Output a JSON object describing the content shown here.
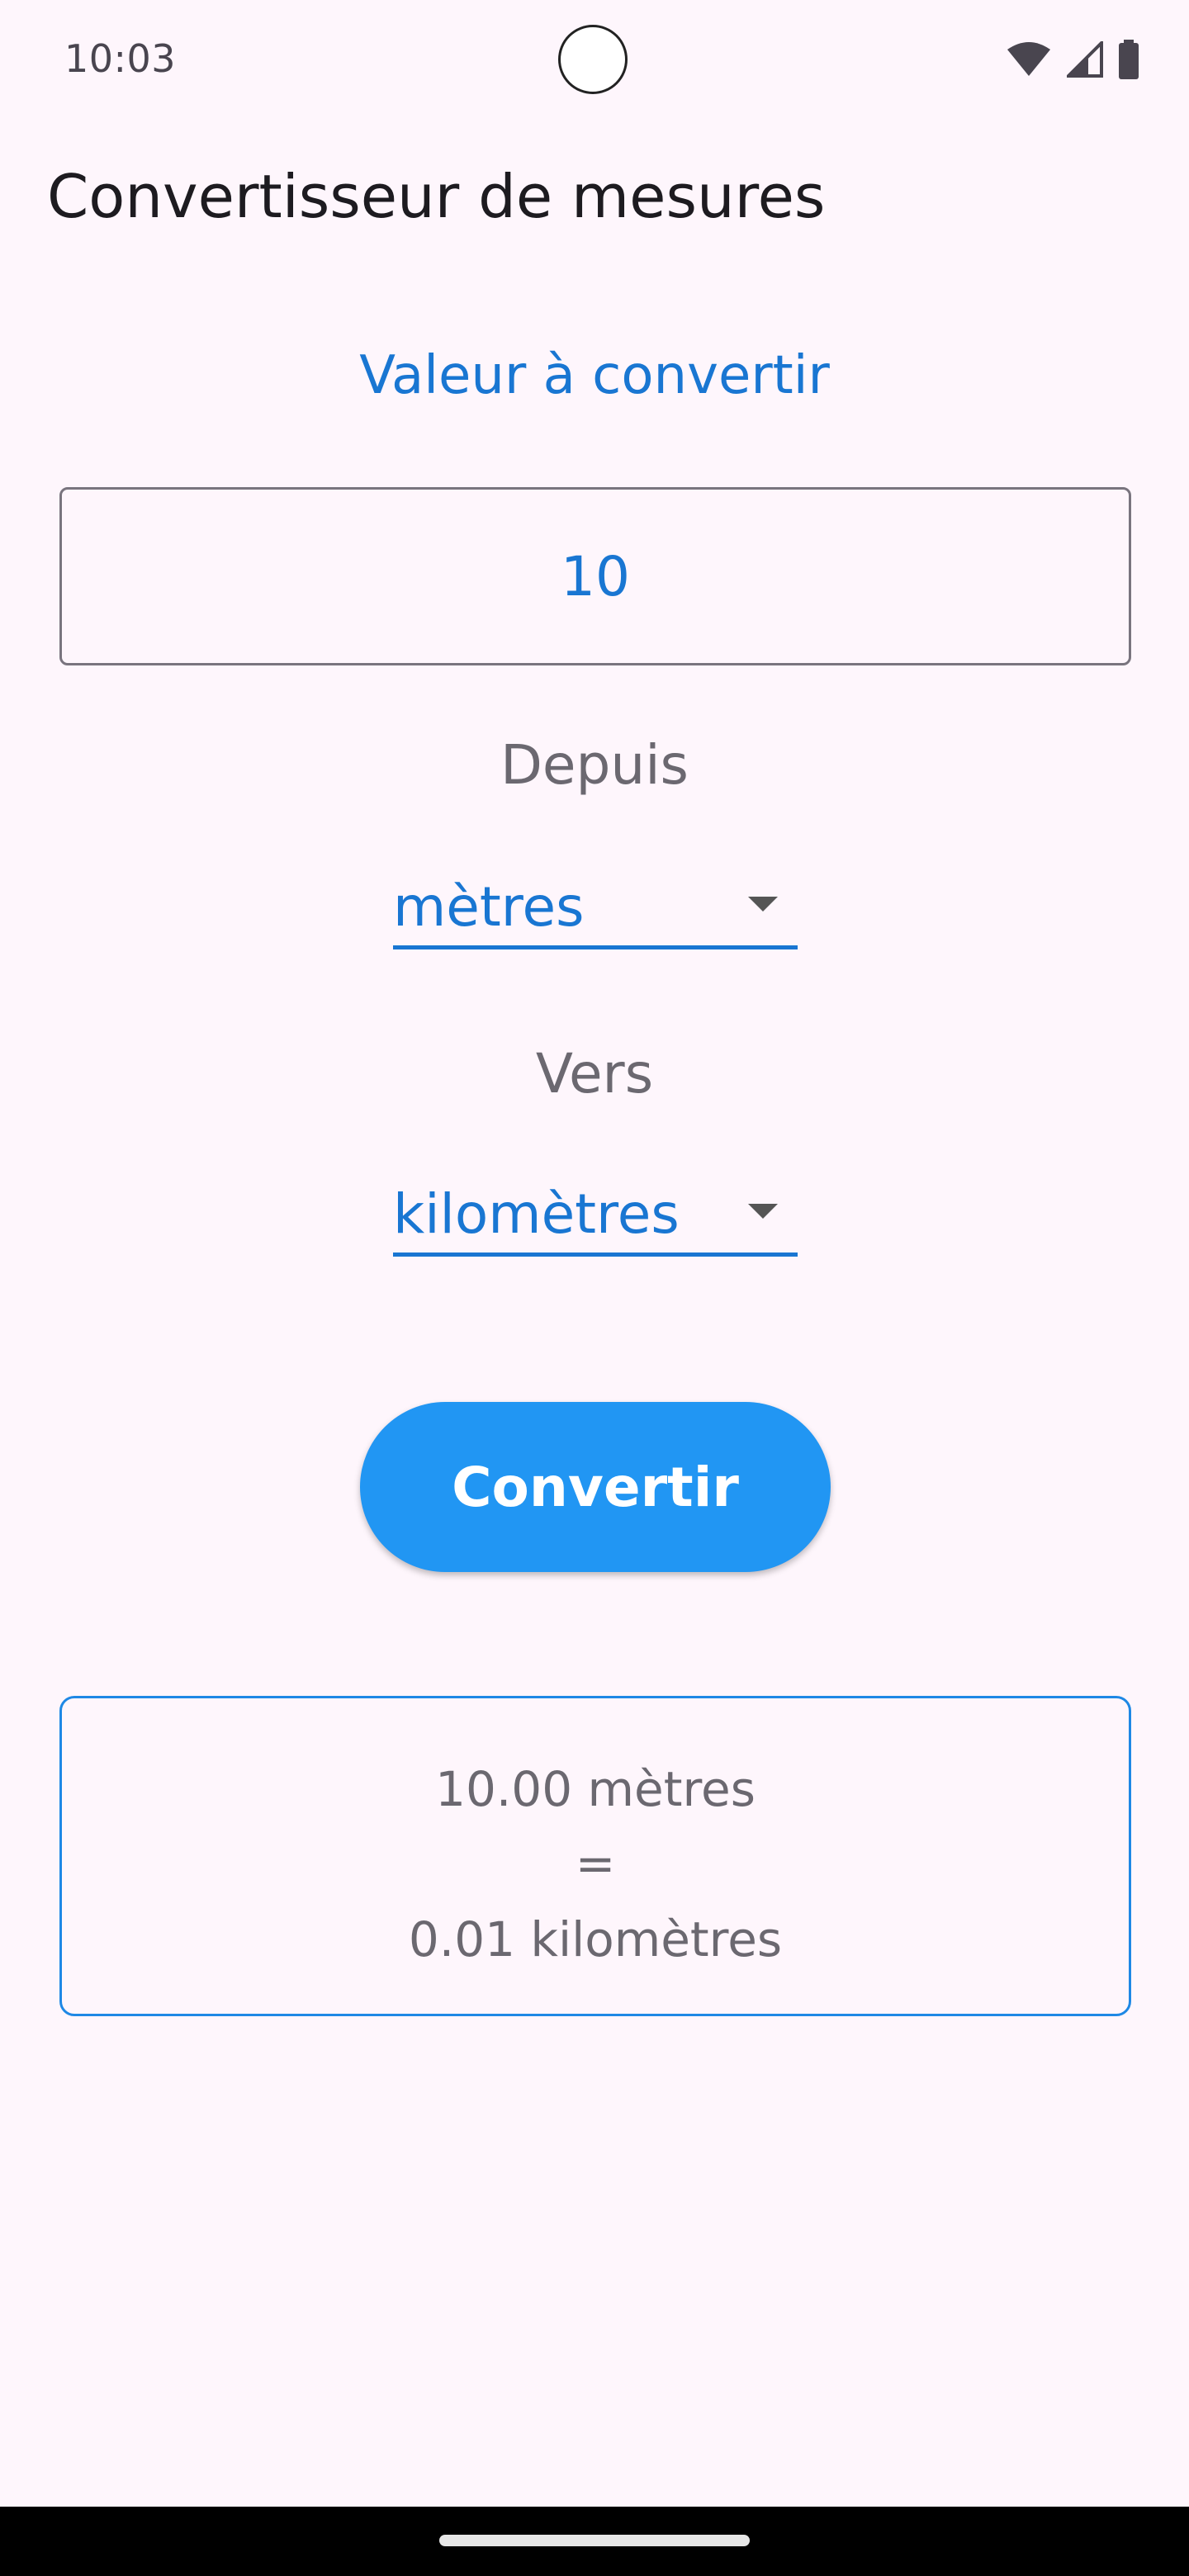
{
  "status_bar": {
    "time": "10:03",
    "icons": [
      "wifi-icon",
      "cellular-signal-icon",
      "battery-icon"
    ]
  },
  "app": {
    "title": "Convertisseur de mesures"
  },
  "form": {
    "value_label": "Valeur à convertir",
    "value": "10",
    "from_label": "Depuis",
    "from_unit": "mètres",
    "to_label": "Vers",
    "to_unit": "kilomètres",
    "convert_label": "Convertir"
  },
  "result": {
    "line1": "10.00 mètres",
    "line2": "=",
    "line3": "0.01 kilomètres"
  },
  "colors": {
    "accent": "#1976d2",
    "button": "#2196f3",
    "background": "#fef6fc",
    "muted_text": "#6b6870"
  }
}
